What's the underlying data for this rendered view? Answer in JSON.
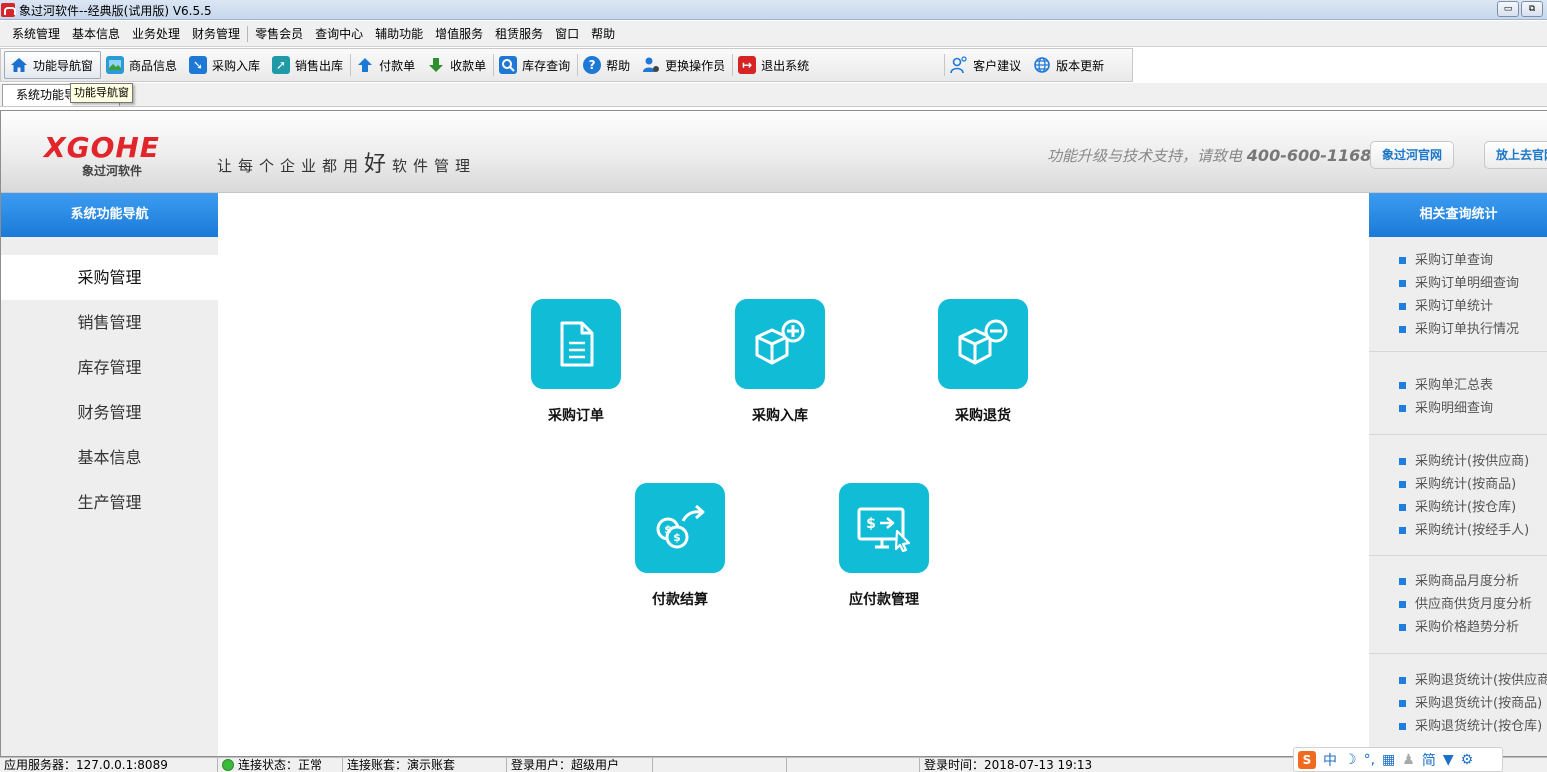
{
  "window": {
    "title": "象过河软件--经典版(试用版) V6.5.5",
    "minimize": "▭",
    "restore": "⧉"
  },
  "menu": [
    "系统管理",
    "基本信息",
    "业务处理",
    "财务管理",
    "零售会员",
    "查询中心",
    "辅助功能",
    "增值服务",
    "租赁服务",
    "窗口",
    "帮助"
  ],
  "toolbar": [
    {
      "label": "功能导航窗",
      "icon": "home-icon",
      "color": "#1b6fd1"
    },
    {
      "label": "商品信息",
      "icon": "product-icon",
      "color": "#2a9bd8"
    },
    {
      "label": "采购入库",
      "icon": "purchase-in-icon",
      "color": "#1d78d6"
    },
    {
      "label": "销售出库",
      "icon": "sales-out-icon",
      "color": "#1f9aa6"
    },
    {
      "label": "付款单",
      "icon": "payment-icon",
      "color": "#1d78d6"
    },
    {
      "label": "收款单",
      "icon": "receipt-icon",
      "color": "#2f8f2f"
    },
    {
      "label": "库存查询",
      "icon": "stock-search-icon",
      "color": "#1d78d6"
    },
    {
      "label": "帮助",
      "icon": "help-icon",
      "color": "#1d78d6"
    },
    {
      "label": "更换操作员",
      "icon": "switch-user-icon",
      "color": "#1d78d6"
    },
    {
      "label": "退出系统",
      "icon": "exit-icon",
      "color": "#d62424"
    },
    {
      "label": "客户建议",
      "icon": "feedback-icon",
      "color": "#1d78d6"
    },
    {
      "label": "版本更新",
      "icon": "globe-icon",
      "color": "#1d78d6"
    }
  ],
  "tabs": {
    "active": "系统功能导航",
    "tooltip": "功能导航窗"
  },
  "banner": {
    "brand": "XGOHE",
    "brand_sub": "象过河软件",
    "slogan_pre": "让每个企业都用",
    "slogan_big": "好",
    "slogan_post": "软件管理",
    "support_text": "功能升级与技术支持，请致电",
    "phone": "400-600-1168",
    "btn_official": "象过河官网",
    "btn_cloud": "放上去官网"
  },
  "left_nav": {
    "title": "系统功能导航",
    "items": [
      "采购管理",
      "销售管理",
      "库存管理",
      "财务管理",
      "基本信息",
      "生产管理"
    ],
    "selected": "采购管理"
  },
  "main": {
    "functions": [
      {
        "label": "采购订单",
        "icon": "document-icon"
      },
      {
        "label": "采购入库",
        "icon": "box-plus-icon"
      },
      {
        "label": "采购退货",
        "icon": "box-minus-icon"
      },
      {
        "label": "付款结算",
        "icon": "coins-transfer-icon"
      },
      {
        "label": "应付款管理",
        "icon": "monitor-payment-icon"
      }
    ]
  },
  "right_nav": {
    "title": "相关查询统计",
    "groups": [
      [
        "采购订单查询",
        "采购订单明细查询",
        "采购订单统计",
        "采购订单执行情况"
      ],
      [
        "采购单汇总表",
        "采购明细查询"
      ],
      [
        "采购统计(按供应商)",
        "采购统计(按商品)",
        "采购统计(按仓库)",
        "采购统计(按经手人)"
      ],
      [
        "采购商品月度分析",
        "供应商供货月度分析",
        "采购价格趋势分析"
      ],
      [
        "采购退货统计(按供应商)",
        "采购退货统计(按商品)",
        "采购退货统计(按仓库)"
      ]
    ]
  },
  "status": {
    "server": "应用服务器：127.0.0.1:8089",
    "connection": "连接状态：正常",
    "account": "连接账套：演示账套",
    "user": "登录用户：超级用户",
    "login_time": "登录时间：2018-07-13 19:13",
    "ime_items": [
      "中",
      "简"
    ]
  }
}
